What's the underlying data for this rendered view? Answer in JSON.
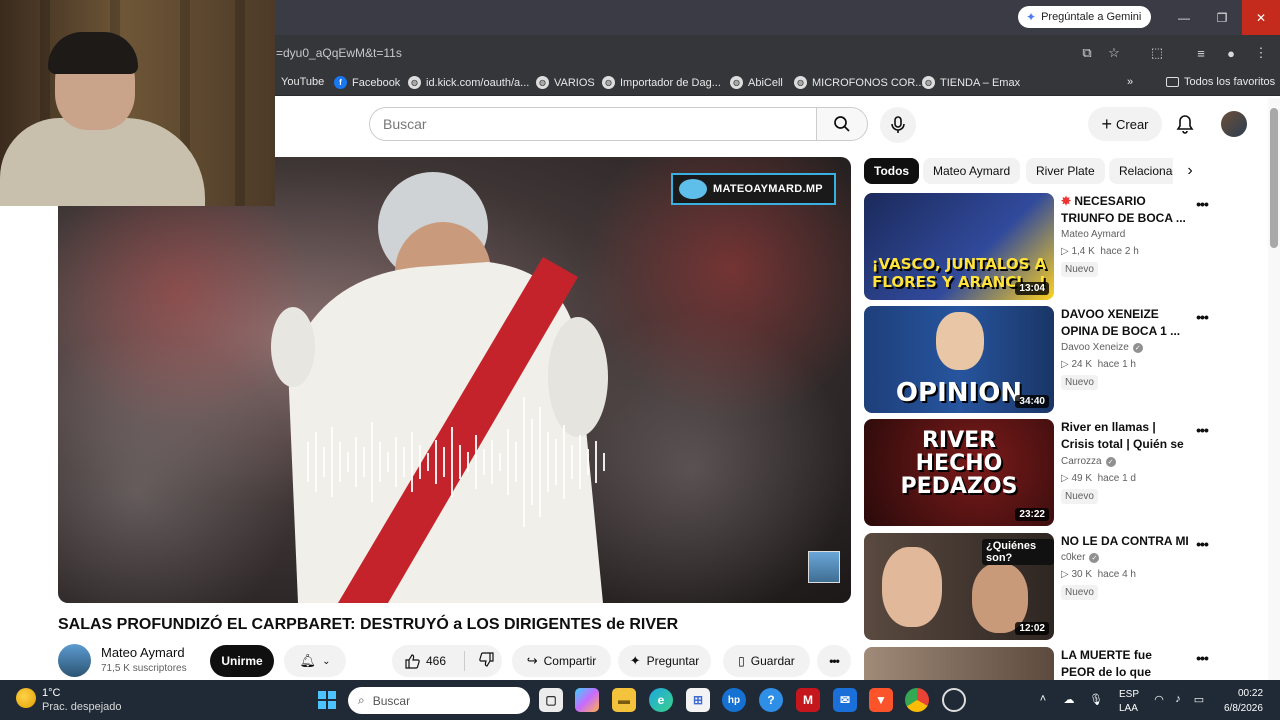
{
  "browser": {
    "gemini_label": "Pregúntale a Gemini",
    "url": "=dyu0_aQqEwM&t=11s",
    "bookmarks": [
      {
        "label": "YouTube"
      },
      {
        "label": "Facebook"
      },
      {
        "label": "id.kick.com/oauth/a..."
      },
      {
        "label": "VARIOS"
      },
      {
        "label": "Importador de Dag..."
      },
      {
        "label": "AbiCell"
      },
      {
        "label": "MICROFONOS COR..."
      },
      {
        "label": "TIENDA – Emax"
      }
    ],
    "bookmarks_more": "»",
    "all_bookmarks": "Todos los favoritos"
  },
  "header": {
    "search_placeholder": "Buscar",
    "create_label": "Crear"
  },
  "player": {
    "watermark": "MATEOAYMARD.MP"
  },
  "video": {
    "title": "SALAS PROFUNDIZÓ EL CARPBARET: DESTRUYÓ a LOS DIRIGENTES de RIVER",
    "channel": "Mateo Aymard",
    "subscribers": "71,5 K suscriptores",
    "join_label": "Unirme",
    "likes": "466",
    "share_label": "Compartir",
    "ask_label": "Preguntar",
    "save_label": "Guardar"
  },
  "chips": [
    "Todos",
    "Mateo Aymard",
    "River Plate",
    "Relacionados"
  ],
  "recommendations": [
    {
      "title": "NECESARIO TRIUNFO DE BOCA ...",
      "channel": "Mateo Aymard",
      "verified": false,
      "views": "1,4 K",
      "age": "hace 2 h",
      "badge": "Nuevo",
      "duration": "13:04",
      "thumb_text": "¡VASCO, JUNTALOS A FLORES Y ARANCI...!",
      "thumb_color": "#1b2a5c"
    },
    {
      "title": "DAVOO XENEIZE OPINA DE BOCA 1 ...",
      "channel": "Davoo Xeneize",
      "verified": true,
      "views": "24 K",
      "age": "hace 1 h",
      "badge": "Nuevo",
      "duration": "34:40",
      "thumb_text": "OPINION",
      "thumb_color": "#1e3f7a"
    },
    {
      "title": "River en llamas | Crisis total | Quién se hace ...",
      "channel": "Carrozza",
      "verified": true,
      "views": "49 K",
      "age": "hace 1 d",
      "badge": "Nuevo",
      "duration": "23:22",
      "thumb_text": "RIVER HECHO PEDAZOS",
      "thumb_color": "#5a1414"
    },
    {
      "title": "NO LE DA CONTRA MI",
      "channel": "c0ker",
      "verified": true,
      "views": "30 K",
      "age": "hace 4 h",
      "badge": "Nuevo",
      "duration": "12:02",
      "thumb_text": "¿Quiénes son?",
      "thumb_color": "#3b2f2a"
    },
    {
      "title": "LA MUERTE fue PEOR de lo que PENSABAN- ...",
      "channel": "",
      "verified": false,
      "views": "",
      "age": "",
      "badge": "",
      "duration": "",
      "thumb_text": "",
      "thumb_color": "#7a6a5a"
    }
  ],
  "taskbar": {
    "temperature": "1°C",
    "weather": "Prac. despejado",
    "search_placeholder": "Buscar",
    "lang1": "ESP",
    "lang2": "LAA",
    "time": "00:22",
    "date": "6/8/2026"
  }
}
